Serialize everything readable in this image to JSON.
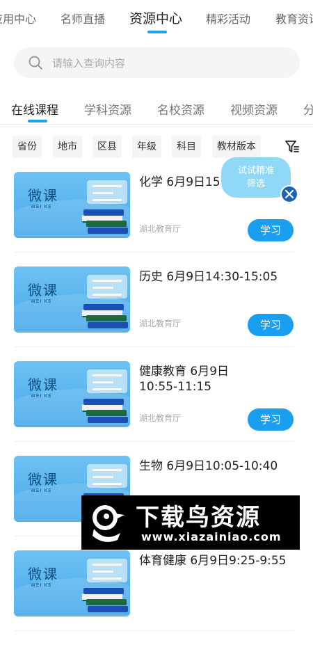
{
  "top_nav": {
    "tabs": [
      "应用中心",
      "名师直播",
      "资源中心",
      "精彩活动",
      "教育资讯"
    ],
    "active": 2
  },
  "search": {
    "placeholder": "请输入查询内容"
  },
  "sub_tabs": {
    "tabs": [
      "在线课程",
      "学科资源",
      "名校资源",
      "视频资源",
      "分"
    ],
    "active": 0
  },
  "filters": [
    "省份",
    "地市",
    "区县",
    "年级",
    "科目",
    "教材版本"
  ],
  "thumb_text": {
    "main": "微课",
    "sub": "WEI KE"
  },
  "courses": [
    {
      "title": "化学 6月9日15",
      "org": "湖北教育厅",
      "action": "学习"
    },
    {
      "title": "历史 6月9日14:30-15:05",
      "org": "湖北教育厅",
      "action": "学习"
    },
    {
      "title": "健康教育 6月9日\n10:55-11:15",
      "org": "湖北教育厅",
      "action": "学习"
    },
    {
      "title": "生物 6月9日10:05-10:40",
      "org": "",
      "action": ""
    },
    {
      "title": "体育健康 6月9日9:25-9:55",
      "org": "",
      "action": ""
    }
  ],
  "float_bubble": {
    "line1": "试试精准",
    "line2": "筛选"
  },
  "watermark": {
    "title": "下载鸟资源",
    "url": "www.xiazainiao.com"
  },
  "colors": {
    "accent": "#1a9ff0",
    "thumb": "#4aaaea",
    "bubble": "#8fd8f7",
    "close": "#1e63b5"
  }
}
